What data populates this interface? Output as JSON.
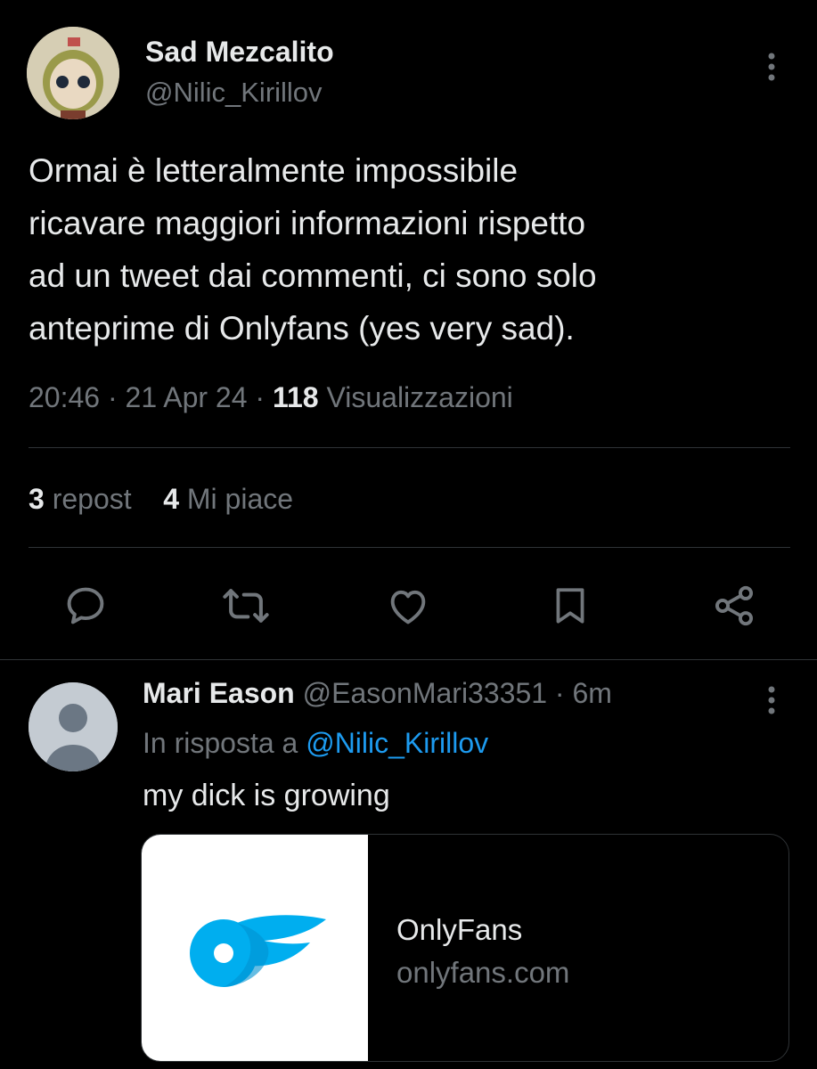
{
  "main_tweet": {
    "author_name": "Sad Mezcalito",
    "author_handle": "@Nilic_Kirillov",
    "text": "Ormai è letteralmente impossibile\nricavare maggiori informazioni rispetto\nad un tweet dai commenti, ci sono solo\nanteprime di Onlyfans (yes very sad).",
    "time": "20:46",
    "date": "21 Apr 24",
    "separator": "·",
    "views_count": "118",
    "views_label": "Visualizzazioni",
    "reposts_count": "3",
    "reposts_label": "repost",
    "likes_count": "4",
    "likes_label": "Mi piace"
  },
  "actions": [
    {
      "name": "reply",
      "icon": "reply-icon"
    },
    {
      "name": "repost",
      "icon": "repost-icon"
    },
    {
      "name": "like",
      "icon": "heart-icon"
    },
    {
      "name": "bookmark",
      "icon": "bookmark-icon"
    },
    {
      "name": "share",
      "icon": "share-icon"
    }
  ],
  "reply": {
    "author_name": "Mari Eason",
    "author_handle": "@EasonMari33351",
    "separator": "·",
    "age": "6m",
    "reply_to_prefix": "In risposta a",
    "reply_to_handle": "@Nilic_Kirillov",
    "text": "my dick is growing",
    "card": {
      "title": "OnlyFans",
      "domain": "onlyfans.com",
      "logo_color": "#00aeef"
    }
  },
  "colors": {
    "background": "#000000",
    "text": "#e7e9ea",
    "muted": "#71767b",
    "link": "#1d9bf0",
    "divider": "#2f3336"
  }
}
